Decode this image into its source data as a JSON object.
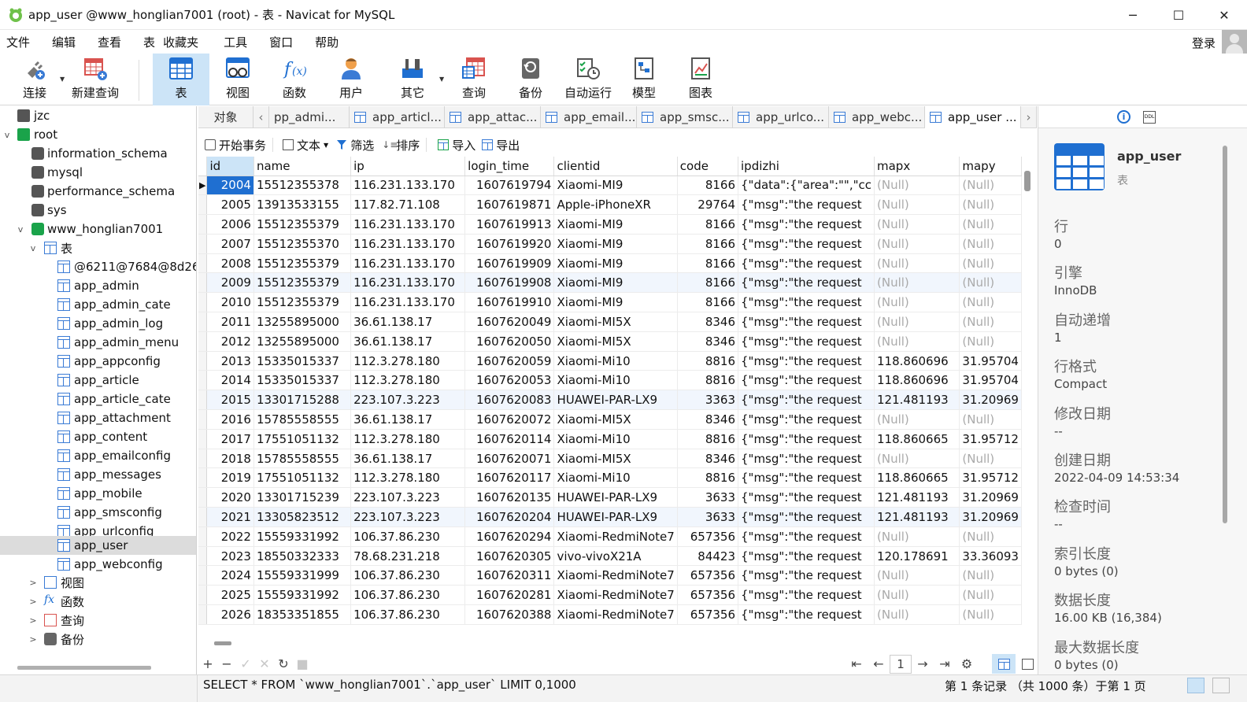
{
  "window": {
    "title": "app_user @www_honglian7001 (root) - 表 - Navicat for MySQL",
    "minimize": "─",
    "maximize": "☐",
    "close": "✕"
  },
  "menu": {
    "items": [
      "文件",
      "编辑",
      "查看",
      "表",
      "收藏夹",
      "工具",
      "窗口",
      "帮助"
    ],
    "login": "登录"
  },
  "toolbar": {
    "connect": "连接",
    "new_query": "新建查询",
    "table": "表",
    "view": "视图",
    "function": "函数",
    "user": "用户",
    "other": "其它",
    "query": "查询",
    "backup": "备份",
    "automation": "自动运行",
    "model": "模型",
    "chart": "图表"
  },
  "tree": {
    "conn_jzc": "jzc",
    "conn_root": "root",
    "dbs": [
      "information_schema",
      "mysql",
      "performance_schema",
      "sys"
    ],
    "active_db": "www_honglian7001",
    "tables_node": "表",
    "tables": [
      "@6211@7684@8d26",
      "app_admin",
      "app_admin_cate",
      "app_admin_log",
      "app_admin_menu",
      "app_appconfig",
      "app_article",
      "app_article_cate",
      "app_attachment",
      "app_content",
      "app_emailconfig",
      "app_messages",
      "app_mobile",
      "app_smsconfig",
      "app_urlconfig",
      "app_user",
      "app_webconfig"
    ],
    "selected_table": "app_user",
    "views_node": "视图",
    "functions_node": "函数",
    "queries_node": "查询",
    "backups_node": "备份"
  },
  "tabs": {
    "objects": "对象",
    "items": [
      "pp_admi...",
      "app_articl...",
      "app_attac...",
      "app_email...",
      "app_smsc...",
      "app_urlco...",
      "app_webc...",
      "app_user ..."
    ],
    "active_index": 7
  },
  "subtoolbar": {
    "begin_transaction": "开始事务",
    "text": "文本",
    "filter": "筛选",
    "sort": "排序",
    "import": "导入",
    "export": "导出"
  },
  "grid": {
    "columns": [
      "id",
      "name",
      "ip",
      "login_time",
      "clientid",
      "code",
      "ipdizhi",
      "mapx",
      "mapy"
    ],
    "null_text": "(Null)",
    "rows": [
      [
        "2004",
        "15512355378",
        "116.231.133.170",
        "1607619794",
        "Xiaomi-MI9",
        "8166",
        "{\"data\":{\"area\":\"\",\"cc",
        null,
        null
      ],
      [
        "2005",
        "13913533155",
        "117.82.71.108",
        "1607619871",
        "Apple-iPhoneXR",
        "29764",
        "{\"msg\":\"the request",
        null,
        null
      ],
      [
        "2006",
        "15512355379",
        "116.231.133.170",
        "1607619913",
        "Xiaomi-MI9",
        "8166",
        "{\"msg\":\"the request",
        null,
        null
      ],
      [
        "2007",
        "15512355370",
        "116.231.133.170",
        "1607619920",
        "Xiaomi-MI9",
        "8166",
        "{\"msg\":\"the request",
        null,
        null
      ],
      [
        "2008",
        "15512355379",
        "116.231.133.170",
        "1607619909",
        "Xiaomi-MI9",
        "8166",
        "{\"msg\":\"the request",
        null,
        null
      ],
      [
        "2009",
        "15512355379",
        "116.231.133.170",
        "1607619908",
        "Xiaomi-MI9",
        "8166",
        "{\"msg\":\"the request",
        null,
        null
      ],
      [
        "2010",
        "15512355379",
        "116.231.133.170",
        "1607619910",
        "Xiaomi-MI9",
        "8166",
        "{\"msg\":\"the request",
        null,
        null
      ],
      [
        "2011",
        "13255895000",
        "36.61.138.17",
        "1607620049",
        "Xiaomi-MI5X",
        "8346",
        "{\"msg\":\"the request",
        null,
        null
      ],
      [
        "2012",
        "13255895000",
        "36.61.138.17",
        "1607620050",
        "Xiaomi-MI5X",
        "8346",
        "{\"msg\":\"the request",
        null,
        null
      ],
      [
        "2013",
        "15335015337",
        "112.3.278.180",
        "1607620059",
        "Xiaomi-Mi10",
        "8816",
        "{\"msg\":\"the request",
        "118.860696",
        "31.95704"
      ],
      [
        "2014",
        "15335015337",
        "112.3.278.180",
        "1607620053",
        "Xiaomi-Mi10",
        "8816",
        "{\"msg\":\"the request",
        "118.860696",
        "31.95704"
      ],
      [
        "2015",
        "13301715288",
        "223.107.3.223",
        "1607620083",
        "HUAWEI-PAR-LX9",
        "3363",
        "{\"msg\":\"the request",
        "121.481193",
        "31.20969"
      ],
      [
        "2016",
        "15785558555",
        "36.61.138.17",
        "1607620072",
        "Xiaomi-MI5X",
        "8346",
        "{\"msg\":\"the request",
        null,
        null
      ],
      [
        "2017",
        "17551051132",
        "112.3.278.180",
        "1607620114",
        "Xiaomi-Mi10",
        "8816",
        "{\"msg\":\"the request",
        "118.860665",
        "31.95712"
      ],
      [
        "2018",
        "15785558555",
        "36.61.138.17",
        "1607620071",
        "Xiaomi-MI5X",
        "8346",
        "{\"msg\":\"the request",
        null,
        null
      ],
      [
        "2019",
        "17551051132",
        "112.3.278.180",
        "1607620117",
        "Xiaomi-Mi10",
        "8816",
        "{\"msg\":\"the request",
        "118.860665",
        "31.95712"
      ],
      [
        "2020",
        "13301715239",
        "223.107.3.223",
        "1607620135",
        "HUAWEI-PAR-LX9",
        "3633",
        "{\"msg\":\"the request",
        "121.481193",
        "31.20969"
      ],
      [
        "2021",
        "13305823512",
        "223.107.3.223",
        "1607620204",
        "HUAWEI-PAR-LX9",
        "3633",
        "{\"msg\":\"the request",
        "121.481193",
        "31.20969"
      ],
      [
        "2022",
        "15559331992",
        "106.37.86.230",
        "1607620294",
        "Xiaomi-RedmiNote7",
        "657356",
        "{\"msg\":\"the request",
        null,
        null
      ],
      [
        "2023",
        "18550332333",
        "78.68.231.218",
        "1607620305",
        "vivo-vivoX21A",
        "84423",
        "{\"msg\":\"the request",
        "120.178691",
        "33.36093"
      ],
      [
        "2024",
        "15559331999",
        "106.37.86.230",
        "1607620311",
        "Xiaomi-RedmiNote7",
        "657356",
        "{\"msg\":\"the request",
        null,
        null
      ],
      [
        "2025",
        "15559331992",
        "106.37.86.230",
        "1607620281",
        "Xiaomi-RedmiNote7",
        "657356",
        "{\"msg\":\"the request",
        null,
        null
      ],
      [
        "2026",
        "18353351855",
        "106.37.86.230",
        "1607620388",
        "Xiaomi-RedmiNote7",
        "657356",
        "{\"msg\":\"the request",
        null,
        null
      ]
    ],
    "selected_row": 0,
    "highlighted_rows": [
      5,
      11,
      17
    ]
  },
  "gridbar": {
    "add": "+",
    "delete": "−",
    "apply": "✓",
    "discard": "✕",
    "refresh": "↻",
    "stop": "■",
    "first": "⇤",
    "prev": "←",
    "page": "1",
    "next": "→",
    "last": "⇥",
    "settings": "⚙"
  },
  "info": {
    "table_name": "app_user",
    "table_type": "表",
    "fields": [
      {
        "label": "行",
        "value": "0"
      },
      {
        "label": "引擎",
        "value": "InnoDB"
      },
      {
        "label": "自动递增",
        "value": "1"
      },
      {
        "label": "行格式",
        "value": "Compact"
      },
      {
        "label": "修改日期",
        "value": "--"
      },
      {
        "label": "创建日期",
        "value": "2022-04-09 14:53:34"
      },
      {
        "label": "检查时间",
        "value": "--"
      },
      {
        "label": "索引长度",
        "value": "0 bytes (0)"
      },
      {
        "label": "数据长度",
        "value": "16.00 KB (16,384)"
      },
      {
        "label": "最大数据长度",
        "value": "0 bytes (0)"
      }
    ]
  },
  "status": {
    "sql": "SELECT * FROM `www_honglian7001`.`app_user` LIMIT 0,1000",
    "records": "第 1 条记录 （共 1000 条）于第 1 页"
  },
  "colors": {
    "accent": "#1f6fd1",
    "active_bg": "#cce4f7",
    "null_text": "#aaaaaa",
    "db_green": "#1aa34a"
  }
}
